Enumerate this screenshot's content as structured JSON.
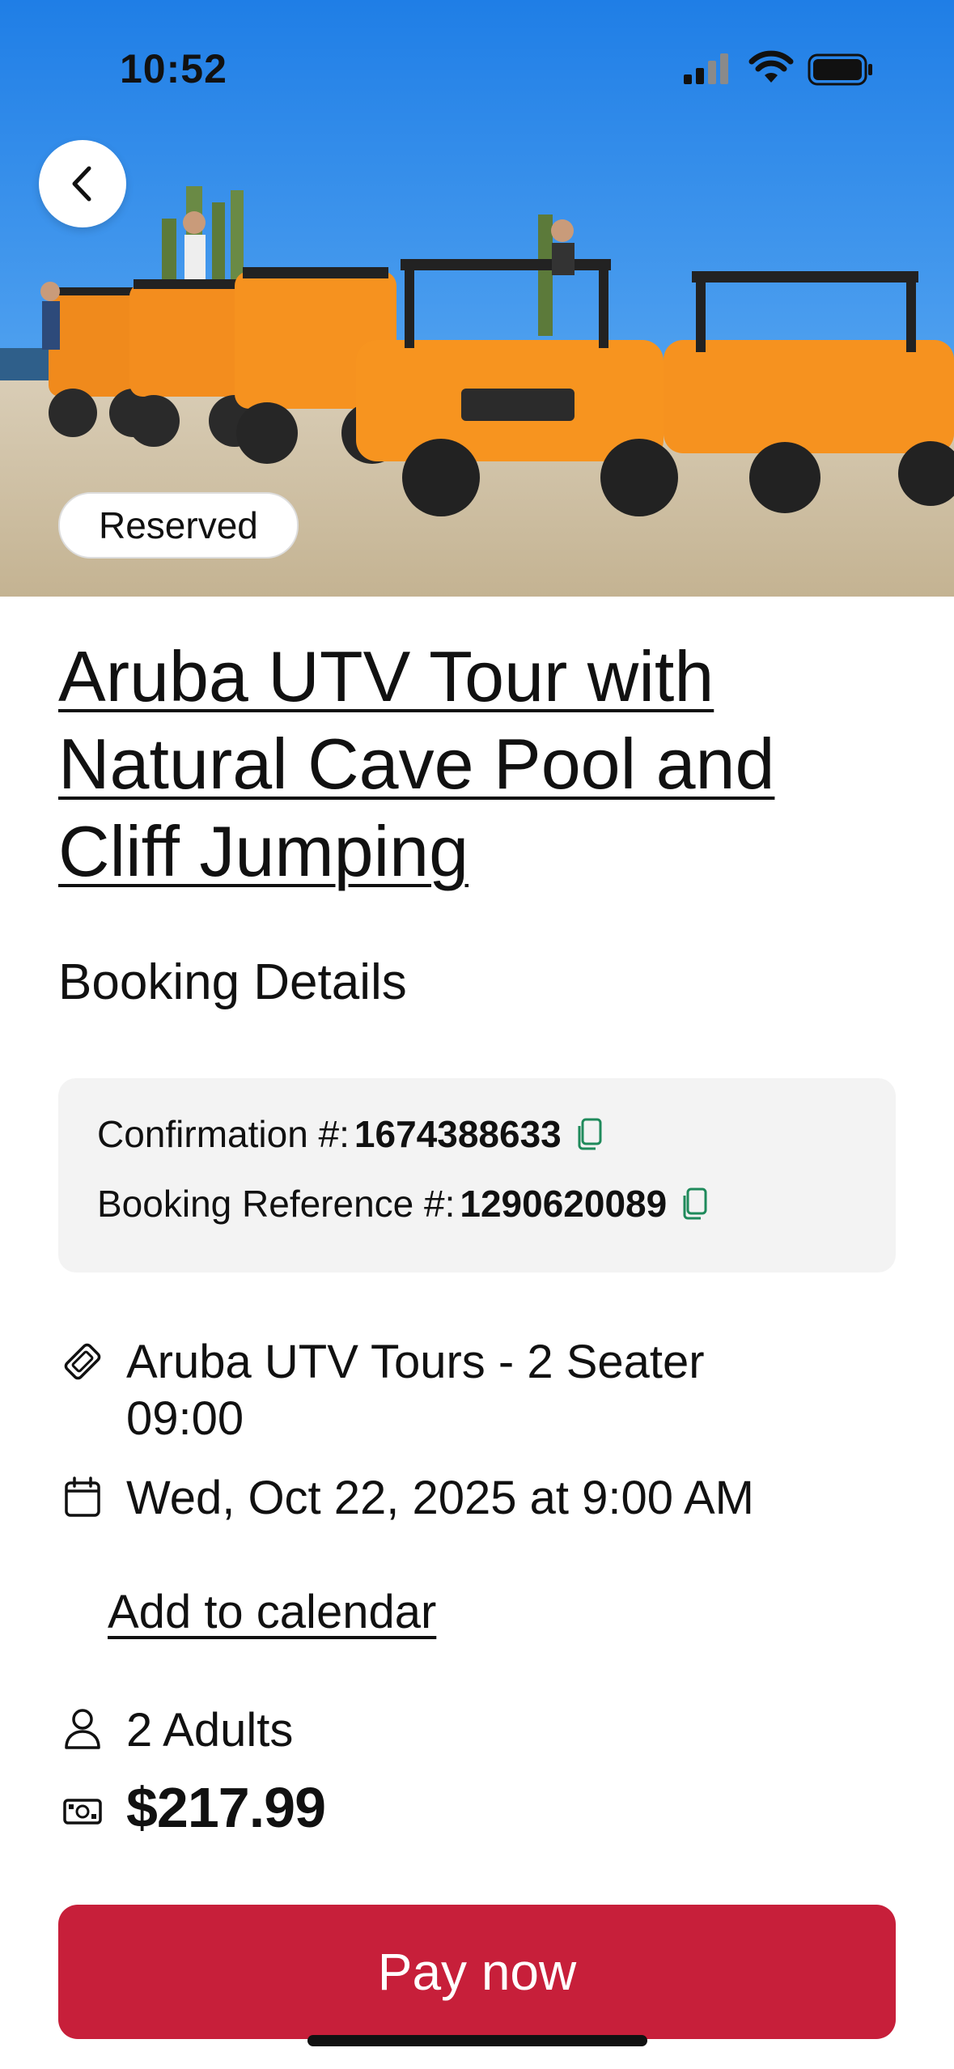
{
  "status_bar": {
    "time": "10:52"
  },
  "hero": {
    "badge": "Reserved"
  },
  "activity": {
    "title": "Aruba UTV Tour with Natural Cave Pool and Cliff Jumping"
  },
  "booking": {
    "section_title": "Booking Details",
    "confirmation_label": "Confirmation #:",
    "confirmation_number": "1674388633",
    "reference_label": "Booking Reference #:",
    "reference_number": "1290620089",
    "option_name": "Aruba UTV Tours - 2 Seater",
    "option_time": "09:00",
    "date_time": "Wed, Oct 22, 2025 at 9:00 AM",
    "add_to_calendar": "Add to calendar",
    "travelers": "2 Adults",
    "price": "$217.99"
  },
  "actions": {
    "pay_now": "Pay now"
  },
  "colors": {
    "primary": "#c71f3a",
    "copy_icon": "#1f8a5b",
    "panel": "#f3f3f3"
  },
  "icons": [
    "back-chevron-icon",
    "copy-icon",
    "ticket-icon",
    "calendar-icon",
    "person-icon",
    "money-icon"
  ]
}
